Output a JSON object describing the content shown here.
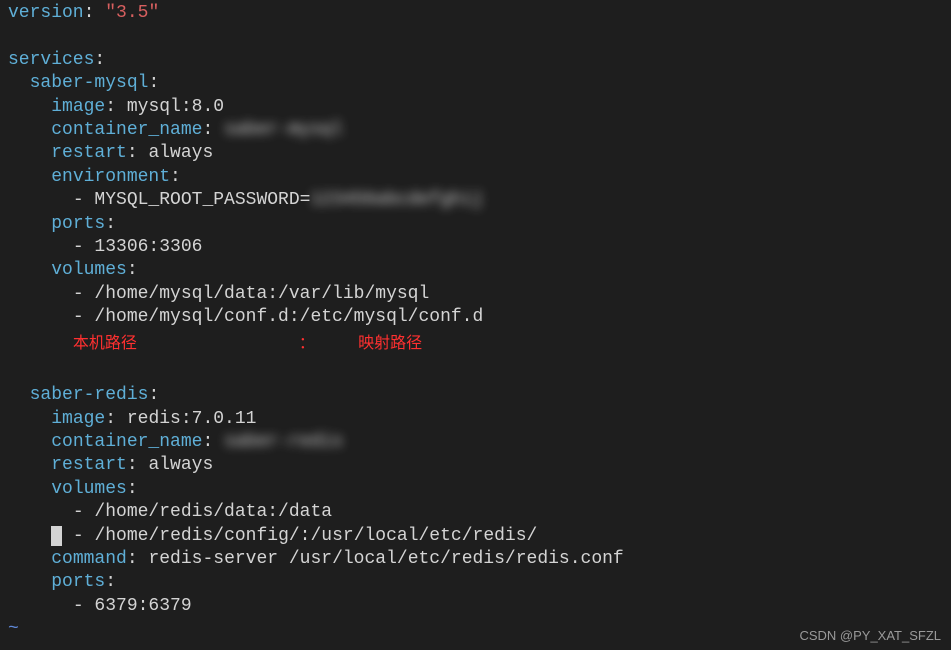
{
  "code": {
    "version_key": "version",
    "version_value": "\"3.5\"",
    "services_key": "services",
    "mysql": {
      "service_name": "saber-mysql",
      "image_key": "image",
      "image_value": "mysql:8.0",
      "container_name_key": "container_name",
      "container_name_value": "saber-mysql",
      "restart_key": "restart",
      "restart_value": "always",
      "environment_key": "environment",
      "mysql_password": "MYSQL_ROOT_PASSWORD=",
      "mysql_password_value": "123456abcdefghij",
      "ports_key": "ports",
      "ports_value": "13306:3306",
      "volumes_key": "volumes",
      "volume1": "/home/mysql/data:/var/lib/mysql",
      "volume2": "/home/mysql/conf.d:/etc/mysql/conf.d"
    },
    "annotation": {
      "local_path": "本机路径",
      "separator": "：",
      "mapped_path": "映射路径"
    },
    "redis": {
      "service_name": "saber-redis",
      "image_key": "image",
      "image_value": "redis:7.0.11",
      "container_name_key": "container_name",
      "container_name_value": "saber-redis",
      "restart_key": "restart",
      "restart_value": "always",
      "volumes_key": "volumes",
      "volume1": "/home/redis/data:/data",
      "volume2": "/home/redis/config/:/usr/local/etc/redis/",
      "command_key": "command",
      "command_value": "redis-server /usr/local/etc/redis/redis.conf",
      "ports_key": "ports",
      "ports_value": "6379:6379"
    }
  },
  "watermark": "CSDN @PY_XAT_SFZL",
  "tilde": "~",
  "cursor": " "
}
